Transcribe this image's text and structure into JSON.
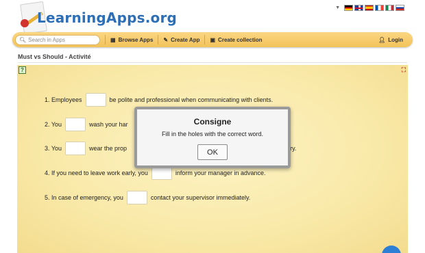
{
  "site": {
    "logo_text": "LearningApps.org"
  },
  "languages": {
    "arrow": "▼",
    "flags": [
      "de",
      "gb",
      "es",
      "fr",
      "it",
      "ru"
    ]
  },
  "nav": {
    "search_placeholder": "Search in Apps",
    "browse_label": "Browse Apps",
    "create_app_label": "Create App",
    "create_collection_label": "Create collection",
    "login_label": "Login",
    "icons": {
      "search": "search-icon",
      "browse": "grid-icon",
      "create_app": "pencil-icon",
      "create_collection": "collection-icon",
      "login": "user-icon"
    }
  },
  "app": {
    "title": "Must vs Should - Activité"
  },
  "exercise": {
    "sentences": [
      {
        "before": "1. Employees",
        "after": "be polite and professional when communicating with clients."
      },
      {
        "before": "2. You",
        "after": "wash your har"
      },
      {
        "before": "3. You",
        "after": "wear the prop",
        "tail": "inery."
      },
      {
        "before": "4. If you need to leave work early, you",
        "after": "inform your manager in advance."
      },
      {
        "before": "5. In case of emergency, you",
        "after": "contact your supervisor immediately."
      }
    ]
  },
  "modal": {
    "title": "Consigne",
    "text": "Fill in the holes with the correct word.",
    "ok_label": "OK"
  },
  "colors": {
    "navbar": "#f3c35a",
    "logo": "#2d6fb7",
    "content_bg": "#f9e9a8",
    "accent_button": "#2d7fd6"
  }
}
